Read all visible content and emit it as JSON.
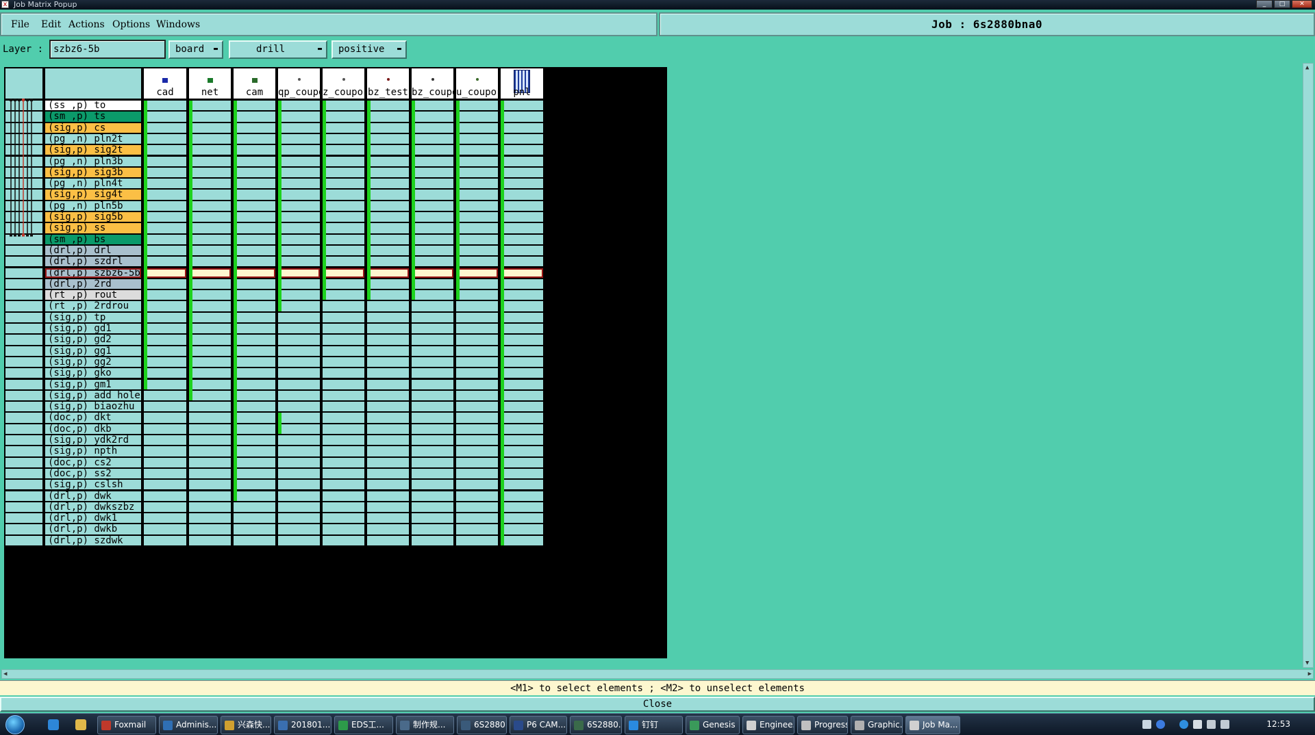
{
  "window": {
    "title": "Job Matrix Popup",
    "min": "_",
    "max": "□",
    "close": "✕"
  },
  "menu": [
    "File",
    "Edit",
    "Actions",
    "Options",
    "Windows"
  ],
  "job": {
    "label": "Job : 6s2880bna0"
  },
  "layer_bar": {
    "label": "Layer :",
    "value": "szbz6-5b",
    "context": "board",
    "type": "drill",
    "polarity": "positive"
  },
  "steps": [
    "cad",
    "net",
    "cam",
    "qp_coupo",
    "z_coupor",
    "bz_test",
    "bz_coupo",
    "u_coupor",
    "pnl"
  ],
  "layers": [
    {
      "label": "(ss ,p) to",
      "color": "#ffffff"
    },
    {
      "label": "(sm ,p) ts",
      "color": "#0b9a6a"
    },
    {
      "label": "(sig,p) cs",
      "color": "#fbbf45"
    },
    {
      "label": "(pg ,n) pln2t",
      "color": "#9cdcd8"
    },
    {
      "label": "(sig,p) sig2t",
      "color": "#fbbf45"
    },
    {
      "label": "(pg ,n) pln3b",
      "color": "#9cdcd8"
    },
    {
      "label": "(sig,p) sig3b",
      "color": "#fbbf45"
    },
    {
      "label": "(pg ,n) pln4t",
      "color": "#9cdcd8"
    },
    {
      "label": "(sig,p) sig4t",
      "color": "#fbbf45"
    },
    {
      "label": "(pg ,n) pln5b",
      "color": "#9cdcd8"
    },
    {
      "label": "(sig,p) sig5b",
      "color": "#fbbf45"
    },
    {
      "label": "(sig,p) ss",
      "color": "#fbbf45"
    },
    {
      "label": "(sm ,p) bs",
      "color": "#0b9a6a"
    },
    {
      "label": "(drl,p) drl",
      "color": "#a9c0cd"
    },
    {
      "label": "(drl,p) szdrl",
      "color": "#a9c0cd"
    },
    {
      "label": "(drl,p) szbz6-5b",
      "color": "#a9c0cd"
    },
    {
      "label": "(drl,p) 2rd",
      "color": "#a9c0cd"
    },
    {
      "label": "(rt ,p) rout",
      "color": "#dcdcdc"
    },
    {
      "label": "(rt ,p) 2rdrou",
      "color": "#9cdcd8"
    },
    {
      "label": "(sig,p) tp",
      "color": "#9cdcd8"
    },
    {
      "label": "(sig,p) gd1",
      "color": "#9cdcd8"
    },
    {
      "label": "(sig,p) gd2",
      "color": "#9cdcd8"
    },
    {
      "label": "(sig,p) gg1",
      "color": "#9cdcd8"
    },
    {
      "label": "(sig,p) gg2",
      "color": "#9cdcd8"
    },
    {
      "label": "(sig,p) gko",
      "color": "#9cdcd8"
    },
    {
      "label": "(sig,p) gm1",
      "color": "#9cdcd8"
    },
    {
      "label": "(sig,p) add_hole",
      "color": "#9cdcd8"
    },
    {
      "label": "(sig,p) biaozhu",
      "color": "#9cdcd8"
    },
    {
      "label": "(doc,p) dkt",
      "color": "#9cdcd8"
    },
    {
      "label": "(doc,p) dkb",
      "color": "#9cdcd8"
    },
    {
      "label": "(sig,p) ydk2rd",
      "color": "#9cdcd8"
    },
    {
      "label": "(sig,p) npth",
      "color": "#9cdcd8"
    },
    {
      "label": "(doc,p) cs2",
      "color": "#9cdcd8"
    },
    {
      "label": "(doc,p) ss2",
      "color": "#9cdcd8"
    },
    {
      "label": "(sig,p) cslsh",
      "color": "#9cdcd8"
    },
    {
      "label": "(drl,p) dwk",
      "color": "#9cdcd8"
    },
    {
      "label": "(drl,p) dwkszbz",
      "color": "#9cdcd8"
    },
    {
      "label": "(drl,p) dwk1",
      "color": "#9cdcd8"
    },
    {
      "label": "(drl,p) dwkb",
      "color": "#9cdcd8"
    },
    {
      "label": "(drl,p) szdwk",
      "color": "#9cdcd8"
    }
  ],
  "selected_layer_index": 15,
  "hint": "<M1> to select elements ; <M2> to unselect elements",
  "close_label": "Close",
  "taskbar": {
    "items": [
      "Foxmail",
      "Adminis...",
      "兴森快...",
      "201801...",
      "EDS工...",
      "制作规...",
      "6S2880...",
      "P6 CAM...",
      "6S2880...",
      "钉钉",
      "Genesis",
      "Enginee...",
      "Progress",
      "Graphic...",
      "Job Ma..."
    ],
    "active_index": 14,
    "clock": "12:53"
  }
}
